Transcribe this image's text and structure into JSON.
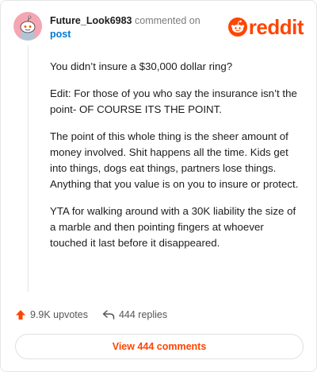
{
  "header": {
    "username": "Future_Look6983",
    "action_text": "commented on",
    "target_link": "post",
    "avatar_icon": "snoo-avatar-icon",
    "logo_icon": "reddit-logo-icon",
    "logo_text": "reddit"
  },
  "comment": {
    "paragraphs": [
      "You didn’t insure a $30,000 dollar ring?",
      "Edit: For those of you who say the insurance isn’t the point- OF COURSE ITS THE POINT.",
      "The point of this whole thing is the sheer amount of money involved. Shit happens all the time. Kids get into things, dogs eat things, partners lose things. Anything that you value is on you to insure or protect.",
      "YTA for walking around with a 30K liability the size of a marble and then pointing fingers at whoever touched it last before it disappeared."
    ]
  },
  "footer": {
    "upvotes": "9.9K upvotes",
    "replies": "444 replies",
    "view_comments": "View 444 comments"
  },
  "colors": {
    "brand": "#ff4500",
    "link": "#0079d3",
    "avatar_bg": "#f4a6b3"
  }
}
